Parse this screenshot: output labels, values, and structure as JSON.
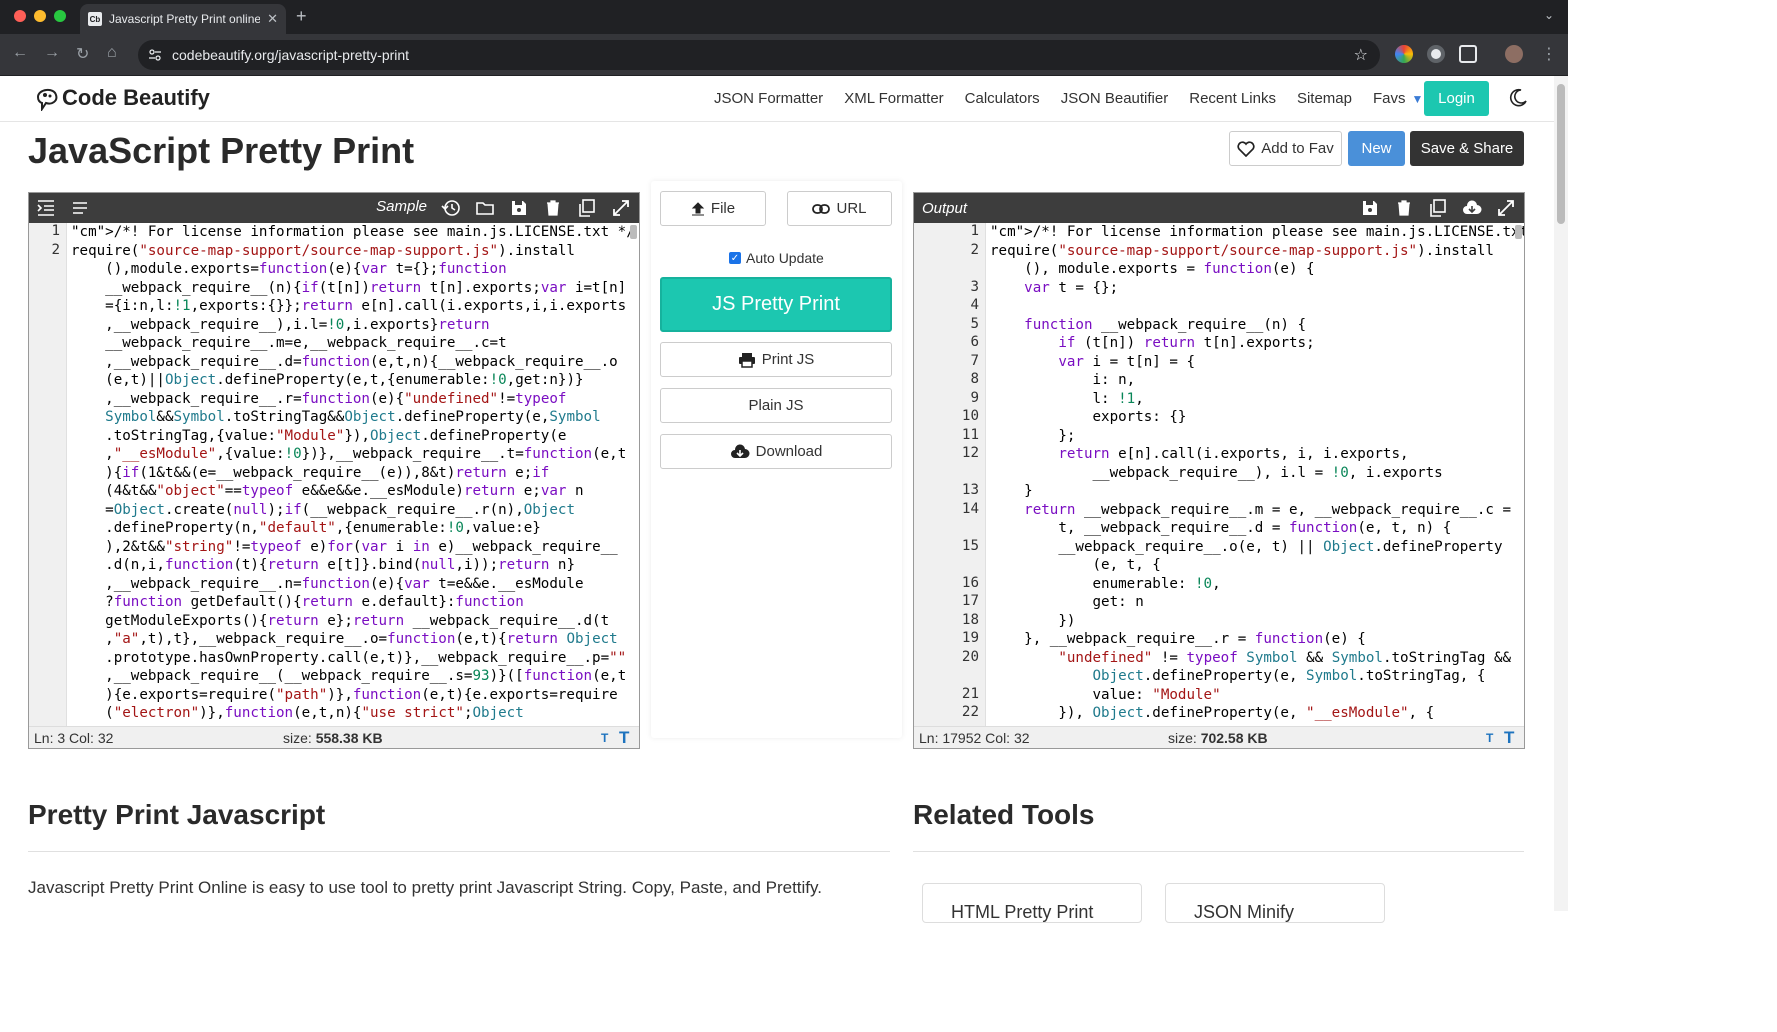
{
  "browser": {
    "tab_title": "Javascript Pretty Print online",
    "url": "codebeautify.org/javascript-pretty-print",
    "tab_fav": "Cb"
  },
  "site": {
    "logo_text": "Code Beautify",
    "nav": [
      "JSON Formatter",
      "XML Formatter",
      "Calculators",
      "JSON Beautifier",
      "Recent Links",
      "Sitemap",
      "Favs"
    ],
    "login": "Login",
    "accent": "#1cc7b0"
  },
  "page": {
    "title": "JavaScript Pretty Print",
    "add_fav": "Add to Fav",
    "new": "New",
    "save_share": "Save & Share"
  },
  "input_editor": {
    "label": "Sample",
    "status": "Ln: 3 Col: 32",
    "size_label": "size:",
    "size_value": "558.38 KB",
    "line_numbers": [
      "1",
      "2"
    ],
    "lines": [
      "/*! For license information please see main.js.LICENSE.txt */",
      "require(\"source-map-support/source-map-support.js\").install",
      "    (),module.exports=function(e){var t={};function",
      "    __webpack_require__(n){if(t[n])return t[n].exports;var i=t[n]",
      "    ={i:n,l:!1,exports:{}};return e[n].call(i.exports,i,i.exports",
      "    ,__webpack_require__),i.l=!0,i.exports}return",
      "    __webpack_require__.m=e,__webpack_require__.c=t",
      "    ,__webpack_require__.d=function(e,t,n){__webpack_require__.o",
      "    (e,t)||Object.defineProperty(e,t,{enumerable:!0,get:n})}",
      "    ,__webpack_require__.r=function(e){\"undefined\"!=typeof",
      "    Symbol&&Symbol.toStringTag&&Object.defineProperty(e,Symbol",
      "    .toStringTag,{value:\"Module\"}),Object.defineProperty(e",
      "    ,\"__esModule\",{value:!0})},__webpack_require__.t=function(e,t",
      "    ){if(1&t&&(e=__webpack_require__(e)),8&t)return e;if",
      "    (4&t&&\"object\"==typeof e&&e&&e.__esModule)return e;var n",
      "    =Object.create(null);if(__webpack_require__.r(n),Object",
      "    .defineProperty(n,\"default\",{enumerable:!0,value:e}",
      "    ),2&t&&\"string\"!=typeof e)for(var i in e)__webpack_require__",
      "    .d(n,i,function(t){return e[t]}.bind(null,i));return n}",
      "    ,__webpack_require__.n=function(e){var t=e&&e.__esModule",
      "    ?function getDefault(){return e.default}:function",
      "    getModuleExports(){return e};return __webpack_require__.d(t",
      "    ,\"a\",t),t},__webpack_require__.o=function(e,t){return Object",
      "    .prototype.hasOwnProperty.call(e,t)},__webpack_require__.p=\"\"",
      "    ,__webpack_require__(__webpack_require__.s=93)}([function(e,t",
      "    ){e.exports=require(\"path\")},function(e,t){e.exports=require",
      "    (\"electron\")},function(e,t,n){\"use strict\";Object"
    ]
  },
  "middle": {
    "file": "File",
    "url": "URL",
    "auto_update": "Auto Update",
    "pretty": "JS Pretty Print",
    "print": "Print JS",
    "plain": "Plain JS",
    "download": "Download"
  },
  "output_editor": {
    "label": "Output",
    "status": "Ln: 17952 Col: 32",
    "size_label": "size:",
    "size_value": "702.58 KB",
    "line_numbers": [
      "1",
      "2",
      "",
      "3",
      "4",
      "5",
      "6",
      "7",
      "8",
      "9",
      "10",
      "11",
      "12",
      "",
      "13",
      "14",
      "",
      "15",
      "",
      "16",
      "17",
      "18",
      "19",
      "20",
      "",
      "21",
      "22"
    ],
    "lines": [
      "/*! For license information please see main.js.LICENSE.txt */",
      "require(\"source-map-support/source-map-support.js\").install",
      "    (), module.exports = function(e) {",
      "    var t = {};",
      "",
      "    function __webpack_require__(n) {",
      "        if (t[n]) return t[n].exports;",
      "        var i = t[n] = {",
      "            i: n,",
      "            l: !1,",
      "            exports: {}",
      "        };",
      "        return e[n].call(i.exports, i, i.exports,",
      "            __webpack_require__), i.l = !0, i.exports",
      "    }",
      "    return __webpack_require__.m = e, __webpack_require__.c =",
      "        t, __webpack_require__.d = function(e, t, n) {",
      "        __webpack_require__.o(e, t) || Object.defineProperty",
      "            (e, t, {",
      "            enumerable: !0,",
      "            get: n",
      "        })",
      "    }, __webpack_require__.r = function(e) {",
      "        \"undefined\" != typeof Symbol && Symbol.toStringTag &&",
      "            Object.defineProperty(e, Symbol.toStringTag, {",
      "            value: \"Module\"",
      "        }), Object.defineProperty(e, \"__esModule\", {"
    ]
  },
  "lower": {
    "heading_left": "Pretty Print Javascript",
    "heading_right": "Related Tools",
    "description": "Javascript Pretty Print Online is easy to use tool to pretty print Javascript String. Copy, Paste, and Prettify.",
    "related": [
      "HTML Pretty Print",
      "JSON Minify"
    ]
  }
}
